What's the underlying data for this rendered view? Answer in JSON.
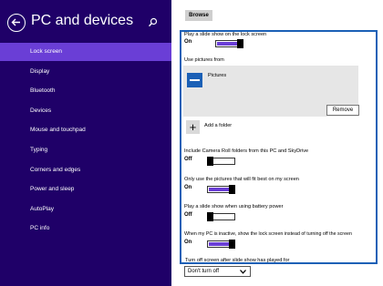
{
  "sidebar": {
    "title": "PC and devices",
    "items": [
      {
        "label": "Lock screen"
      },
      {
        "label": "Display"
      },
      {
        "label": "Bluetooth"
      },
      {
        "label": "Devices"
      },
      {
        "label": "Mouse and touchpad"
      },
      {
        "label": "Typing"
      },
      {
        "label": "Corners and edges"
      },
      {
        "label": "Power and sleep"
      },
      {
        "label": "AutoPlay"
      },
      {
        "label": "PC info"
      }
    ]
  },
  "main": {
    "browse_label": "Browse",
    "slideshow": {
      "label": "Play a slide show on the lock screen",
      "state": "On"
    },
    "use_pictures_label": "Use pictures from",
    "pictures_folder": "Pictures",
    "remove_label": "Remove",
    "add_folder_label": "Add a folder",
    "camera_roll": {
      "label": "Include Camera Roll folders from this PC and SkyDrive",
      "state": "Off"
    },
    "fit_best": {
      "label": "Only use the pictures that will fit best on my screen",
      "state": "On"
    },
    "battery": {
      "label": "Play a slide show when using battery power",
      "state": "Off"
    },
    "inactive": {
      "label": "When my PC is inactive, show the lock screen instead of turning off the screen",
      "state": "On"
    },
    "turn_off_label": "Turn off screen after slide show has played for",
    "turn_off_value": "Don't turn off"
  },
  "colors": {
    "sidebar_bg": "#1f0068",
    "accent": "#6a3ed6",
    "panel_border": "#1b60b6"
  }
}
